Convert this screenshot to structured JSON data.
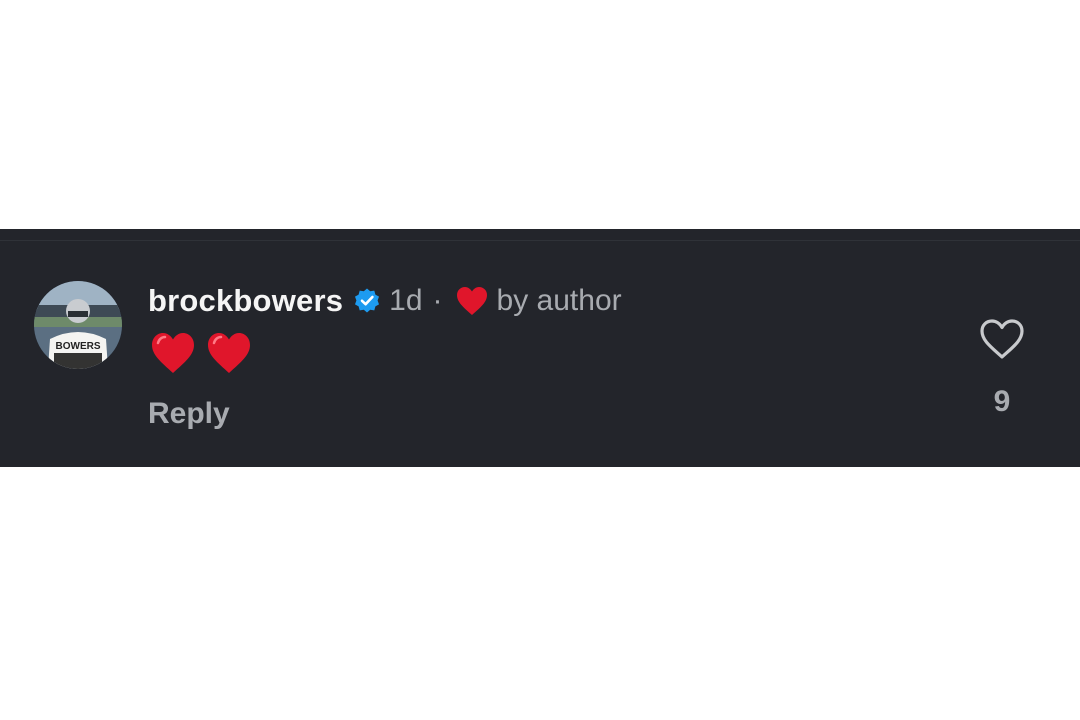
{
  "comment": {
    "username": "brockbowers",
    "verified": true,
    "time": "1d",
    "separator": "·",
    "liked_by_author_text": "by author",
    "body_emoji": [
      "heart-emoji",
      "heart-emoji"
    ],
    "reply_label": "Reply",
    "like_count": "9",
    "avatar_jersey_text": "BOWERS"
  },
  "colors": {
    "panel_background": "#23252b",
    "username": "#f5f5f5",
    "secondary_text": "#a8abb0",
    "verified_badge": "#1d9bf0",
    "heart_red": "#e0162b"
  },
  "icons": {
    "verified": "verified-badge-icon",
    "author_like": "heart-icon",
    "like_button": "heart-outline-icon"
  }
}
